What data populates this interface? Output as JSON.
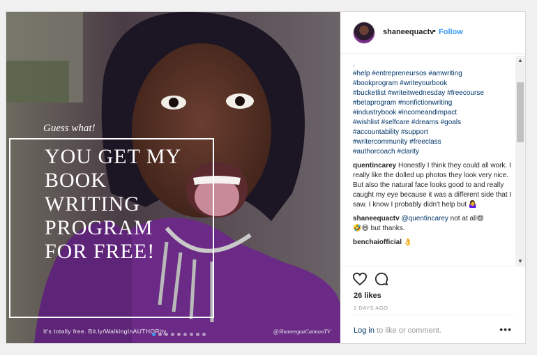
{
  "post": {
    "image_overlay": {
      "kicker": "Guess what!",
      "headline": "You get my\nbook\nwriting\nprogram\nfor free!",
      "footer_left": "It's totally free. Bit.ly/WalkingInAUTHORity",
      "footer_right": "@ShaneequaCannonTV",
      "carousel": {
        "total": 9,
        "active": 1
      }
    },
    "header": {
      "username": "shaneequactv",
      "separator": "•",
      "follow_label": "Follow"
    },
    "caption": {
      "first_line": ".",
      "hashtags": "#help #entrepreneursos #amwriting\n#bookprogram #writeyourbook\n#bucketlist #writeitwednesday #freecourse\n#betaprogram #nonfictionwriting\n#industrybook #incomeandimpact\n#wishlist #selfcare #dreams #goals\n#accountability #support\n#writercommunity #freeclass\n#authorcoach #clarity"
    },
    "comments": [
      {
        "user": "quentincarey",
        "text": " Honestly I think they could all work. I really like the dolled up photos they look very nice. But also the natural face looks good to and really caught my eye because it was a different side that I saw. I know I probably didn't help but ",
        "emoji": "🤷‍♀️"
      },
      {
        "user": "shaneequactv",
        "mention": "@quentincarey",
        "text": " not at all",
        "emoji": "😄",
        "text2": " but thanks.",
        "emoji2": "🤣😄"
      },
      {
        "user": "benchaiofficial",
        "text": " ",
        "emoji": "👌"
      }
    ],
    "actions": {
      "likes": "26 likes",
      "date": "2 DAYS AGO",
      "login_link": "Log in",
      "login_rest": " to like or comment.",
      "more": "•••"
    }
  }
}
